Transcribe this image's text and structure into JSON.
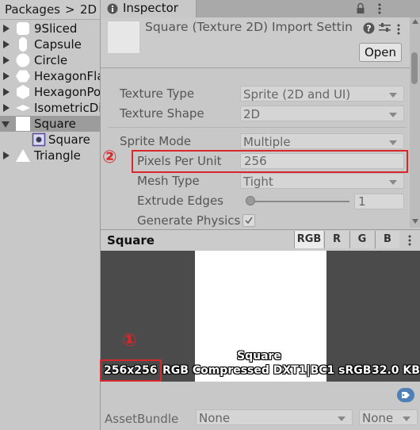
{
  "project": {
    "breadcrumb": {
      "root": "Packages",
      "separator": ">",
      "current": "2D"
    },
    "items": [
      {
        "label": "9Sliced",
        "icon": "rounded-square-shape-icon",
        "expandable": true,
        "expanded": false,
        "selected": false,
        "indent": 0
      },
      {
        "label": "Capsule",
        "icon": "capsule-shape-icon",
        "expandable": true,
        "expanded": false,
        "selected": false,
        "indent": 0
      },
      {
        "label": "Circle",
        "icon": "circle-shape-icon",
        "expandable": true,
        "expanded": false,
        "selected": false,
        "indent": 0
      },
      {
        "label": "HexagonFla",
        "icon": "hexagon-flat-shape-icon",
        "expandable": true,
        "expanded": false,
        "selected": false,
        "indent": 0
      },
      {
        "label": "HexagonPo",
        "icon": "hexagon-pointed-shape-icon",
        "expandable": true,
        "expanded": false,
        "selected": false,
        "indent": 0
      },
      {
        "label": "IsometricDia",
        "icon": "diamond-shape-icon",
        "expandable": true,
        "expanded": false,
        "selected": false,
        "indent": 0
      },
      {
        "label": "Square",
        "icon": "square-shape-icon",
        "expandable": true,
        "expanded": true,
        "selected": true,
        "indent": 0
      },
      {
        "label": "Square",
        "icon": "sprite-icon",
        "expandable": false,
        "expanded": false,
        "selected": false,
        "indent": 1
      },
      {
        "label": "Triangle",
        "icon": "triangle-shape-icon",
        "expandable": true,
        "expanded": false,
        "selected": false,
        "indent": 0
      }
    ]
  },
  "inspector": {
    "tab_label": "Inspector",
    "header_title": "Square (Texture 2D) Import Settin",
    "open_button": "Open",
    "settings": [
      {
        "label": "Texture Type",
        "value": "Sprite (2D and UI)",
        "kind": "dropdown"
      },
      {
        "label": "Texture Shape",
        "value": "2D",
        "kind": "dropdown"
      },
      {
        "label": "Sprite Mode",
        "value": "Multiple",
        "kind": "dropdown"
      },
      {
        "label": "Pixels Per Unit",
        "value": "256",
        "kind": "text"
      },
      {
        "label": "Mesh Type",
        "value": "Tight",
        "kind": "dropdown"
      },
      {
        "label": "Extrude Edges",
        "value": "1",
        "kind": "slider",
        "slider_fraction": 0.0
      },
      {
        "label": "Generate Physics",
        "value": "checked",
        "kind": "checkbox"
      }
    ],
    "preview": {
      "title": "Square",
      "channels": [
        "RGB",
        "R",
        "G",
        "B"
      ],
      "active_channel": "RGB",
      "image_name": "Square",
      "dimensions": "256x256",
      "format_info": "RGB Compressed DXT1|BC1 sRGB",
      "size": "32.0 KB"
    },
    "asset_bundle": {
      "label": "AssetBundle",
      "value": "None",
      "variant": "None"
    }
  },
  "annotations": [
    {
      "number": "①",
      "target": "preview-dimensions"
    },
    {
      "number": "②",
      "target": "pixels-per-unit-field"
    }
  ],
  "colors": {
    "annotation": "#d8282c",
    "selection": "#9c9c9c"
  }
}
